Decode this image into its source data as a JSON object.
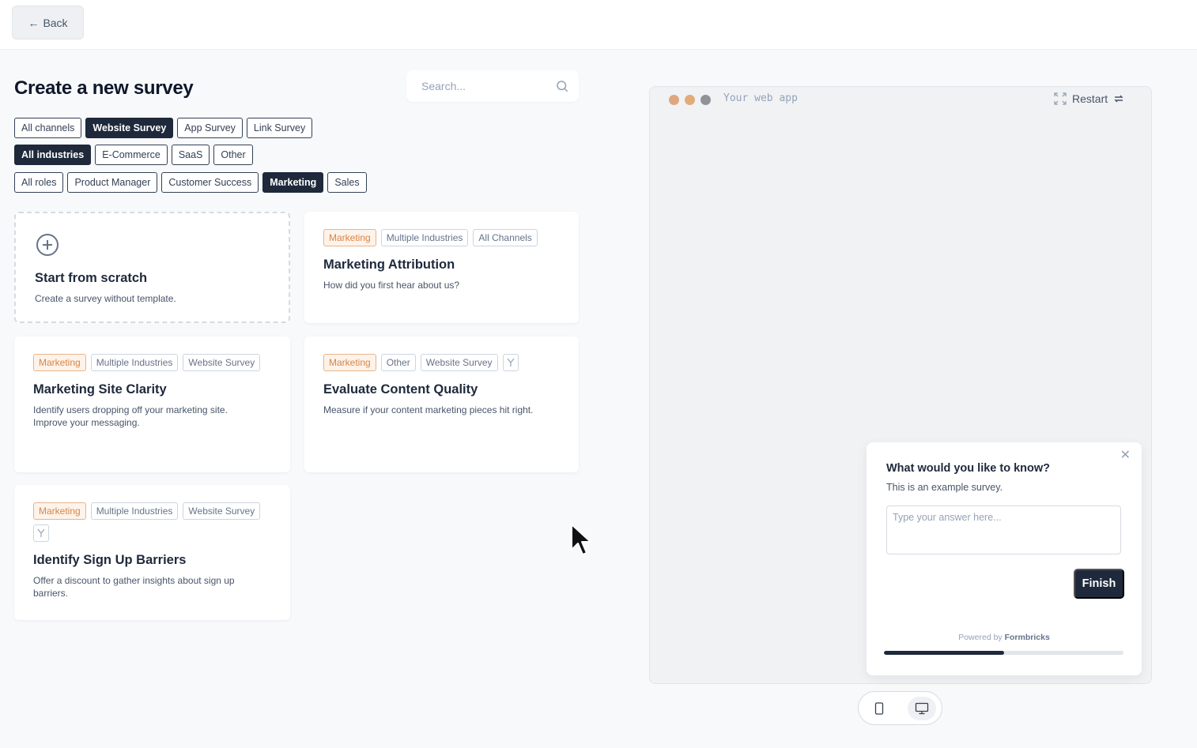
{
  "header": {
    "back_label": "Back"
  },
  "page": {
    "title": "Create a new survey"
  },
  "search": {
    "placeholder": "Search..."
  },
  "filters": {
    "channels": [
      {
        "label": "All channels",
        "active": false
      },
      {
        "label": "Website Survey",
        "active": true
      },
      {
        "label": "App Survey",
        "active": false
      },
      {
        "label": "Link Survey",
        "active": false
      }
    ],
    "industries": [
      {
        "label": "All industries",
        "active": true
      },
      {
        "label": "E-Commerce",
        "active": false
      },
      {
        "label": "SaaS",
        "active": false
      },
      {
        "label": "Other",
        "active": false
      }
    ],
    "roles": [
      {
        "label": "All roles",
        "active": false
      },
      {
        "label": "Product Manager",
        "active": false
      },
      {
        "label": "Customer Success",
        "active": false
      },
      {
        "label": "Marketing",
        "active": true
      },
      {
        "label": "Sales",
        "active": false
      }
    ]
  },
  "scratch": {
    "title": "Start from scratch",
    "description": "Create a survey without template."
  },
  "templates": [
    {
      "tags": [
        "Marketing",
        "Multiple Industries",
        "All Channels"
      ],
      "branching": false,
      "title": "Marketing Attribution",
      "description": "How did you first hear about us?"
    },
    {
      "tags": [
        "Marketing",
        "Multiple Industries",
        "Website Survey"
      ],
      "branching": false,
      "title": "Marketing Site Clarity",
      "description": "Identify users dropping off your marketing site. Improve your messaging."
    },
    {
      "tags": [
        "Marketing",
        "Other",
        "Website Survey"
      ],
      "branching": true,
      "title": "Evaluate Content Quality",
      "description": "Measure if your content marketing pieces hit right."
    },
    {
      "tags": [
        "Marketing",
        "Multiple Industries",
        "Website Survey"
      ],
      "branching": true,
      "title": "Identify Sign Up Barriers",
      "description": "Offer a discount to gather insights about sign up barriers."
    }
  ],
  "preview": {
    "app_label": "Your web app",
    "restart_label": "Restart",
    "widget": {
      "question": "What would you like to know?",
      "subheader": "This is an example survey.",
      "placeholder": "Type your answer here...",
      "finish_label": "Finish",
      "powered_prefix": "Powered by",
      "powered_brand": "Formbricks",
      "progress": 0.5
    },
    "devices": [
      "mobile",
      "desktop"
    ],
    "active_device": "desktop"
  },
  "colors": {
    "accent": "#1e293b",
    "marketing_tag_text": "#d98545",
    "dot_red": "#e0a77f",
    "dot_amber": "#e2ab7a",
    "dot_gray": "#8f9397"
  }
}
